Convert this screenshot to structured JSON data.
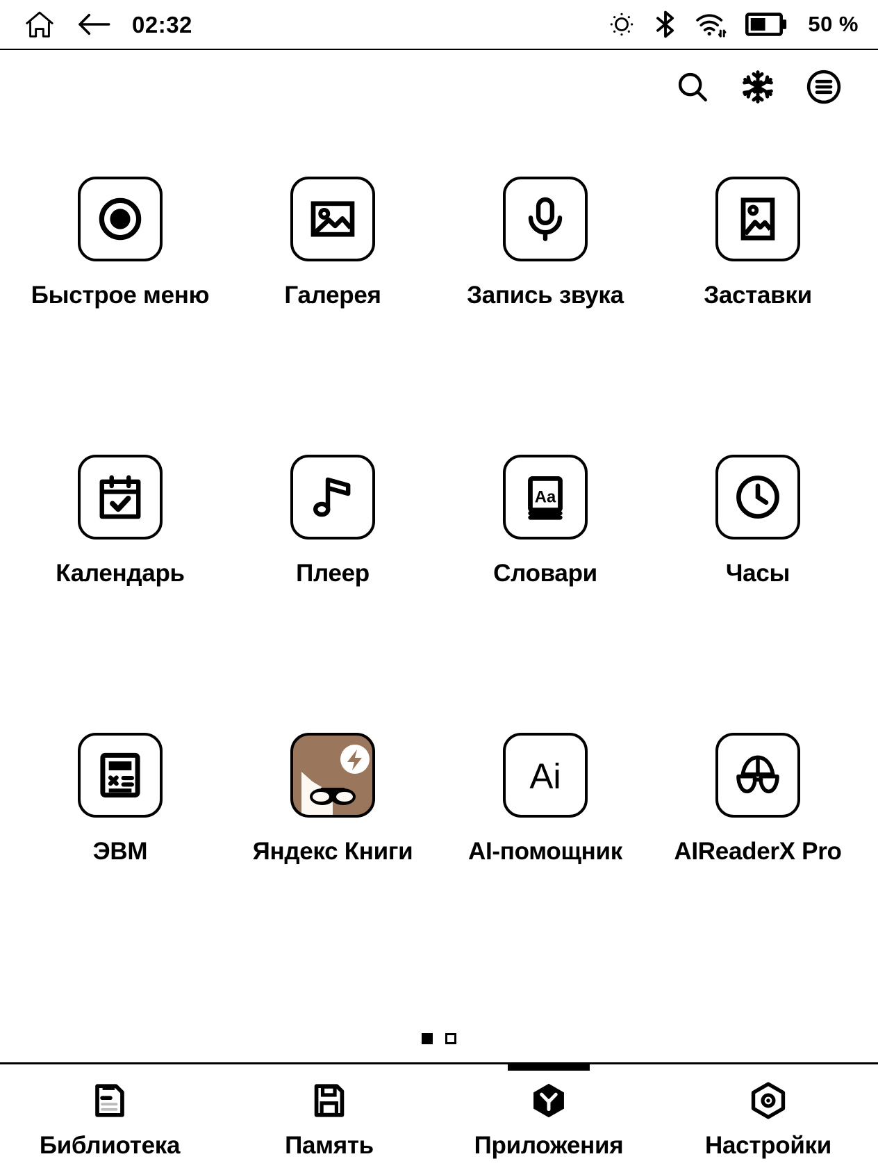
{
  "statusbar": {
    "home_icon": "home-icon",
    "back_icon": "back-arrow-icon",
    "time": "02:32",
    "brightness_icon": "brightness-icon",
    "bluetooth_icon": "bluetooth-icon",
    "wifi_icon": "wifi-icon",
    "battery_icon": "battery-icon",
    "battery_text": "50 %"
  },
  "toolbar": {
    "search_icon": "search-icon",
    "refresh_icon": "snowflake-icon",
    "menu_icon": "hamburger-menu-icon"
  },
  "apps": [
    {
      "label": "Быстрое меню",
      "icon": "record-dot-icon",
      "colored": false
    },
    {
      "label": "Галерея",
      "icon": "image-landscape-icon",
      "colored": false
    },
    {
      "label": "Запись звука",
      "icon": "microphone-icon",
      "colored": false
    },
    {
      "label": "Заставки",
      "icon": "image-portrait-icon",
      "colored": false
    },
    {
      "label": "Календарь",
      "icon": "calendar-check-icon",
      "colored": false
    },
    {
      "label": "Плеер",
      "icon": "music-note-icon",
      "colored": false
    },
    {
      "label": "Словари",
      "icon": "dictionary-aa-icon",
      "colored": false
    },
    {
      "label": "Часы",
      "icon": "clock-icon",
      "colored": false
    },
    {
      "label": "ЭВМ",
      "icon": "calculator-icon",
      "colored": false
    },
    {
      "label": "Яндекс Книги",
      "icon": "yandex-books-icon",
      "colored": true
    },
    {
      "label": "AI-помощник",
      "icon": "ai-text-icon",
      "colored": false
    },
    {
      "label": "AIReaderX Pro",
      "icon": "aireaderx-glasses-icon",
      "colored": false
    }
  ],
  "pagination": {
    "pages": 2,
    "current": 1
  },
  "bottomnav": [
    {
      "label": "Библиотека",
      "icon": "library-book-icon",
      "active": false
    },
    {
      "label": "Память",
      "icon": "floppy-disk-icon",
      "active": false
    },
    {
      "label": "Приложения",
      "icon": "apps-hexagon-icon",
      "active": true
    },
    {
      "label": "Настройки",
      "icon": "settings-hexagon-icon",
      "active": false
    }
  ],
  "colors": {
    "foreground": "#000000",
    "background": "#ffffff",
    "yandex_books_brown": "#99765c",
    "yandex_books_cream": "#fdf8f2"
  }
}
